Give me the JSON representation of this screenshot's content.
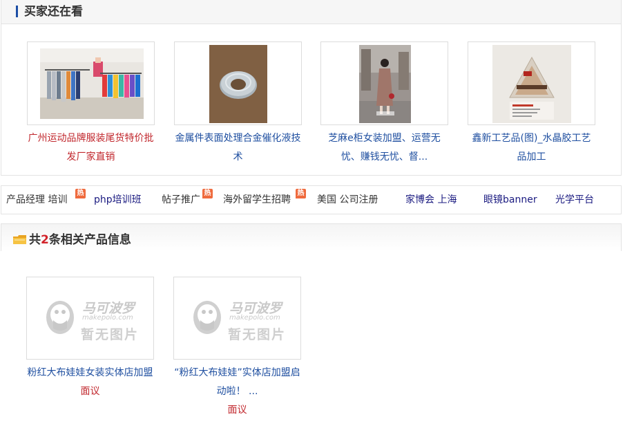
{
  "section_buyers": {
    "title": "买家还在看",
    "items": [
      {
        "caption": "广州运动品牌服装尾货特价批发厂家直销",
        "image": "clothing-store-photo",
        "style": "red"
      },
      {
        "caption": "金属件表面处理合金催化液技术",
        "image": "metal-ring-photo",
        "style": "blue"
      },
      {
        "caption": "芝麻e柜女装加盟、运营无忧、赚钱无忧、督...",
        "image": "woman-coat-photo",
        "style": "blue"
      },
      {
        "caption": "鑫新工艺品(图)_水晶胶工艺品加工",
        "image": "crystal-resin-craft-photo",
        "style": "blue"
      }
    ]
  },
  "tag_links": [
    {
      "label": "产品经理 培训",
      "hot": true
    },
    {
      "label": "php培训班",
      "hot": false
    },
    {
      "label": "帖子推广",
      "hot": true
    },
    {
      "label": "海外留学生招聘",
      "hot": true
    },
    {
      "label": "美国 公司注册",
      "hot": false
    },
    {
      "label": "家博会 上海",
      "hot": false
    },
    {
      "label": "眼镜banner",
      "hot": false
    },
    {
      "label": "光学平台",
      "hot": false
    }
  ],
  "hot_badge": "热",
  "section_related": {
    "title_prefix": "共",
    "count": "2",
    "title_suffix": "条相关产品信息",
    "products": [
      {
        "name": "粉红大布娃娃女装实体店加盟",
        "price": "面议",
        "image": "no-image-placeholder"
      },
      {
        "name": "“粉红大布娃娃”实体店加盟启动啦！ ...",
        "price": "面议",
        "image": "no-image-placeholder"
      }
    ],
    "placeholder_brand": "马可波罗",
    "placeholder_domain": "makepolo.com",
    "placeholder_text": "暂无图片"
  },
  "colors": {
    "link_blue": "#1f4fa0",
    "accent_red": "#c1272d",
    "hot_orange": "#ef6a3d",
    "title_bar": "#1c4ea5"
  }
}
